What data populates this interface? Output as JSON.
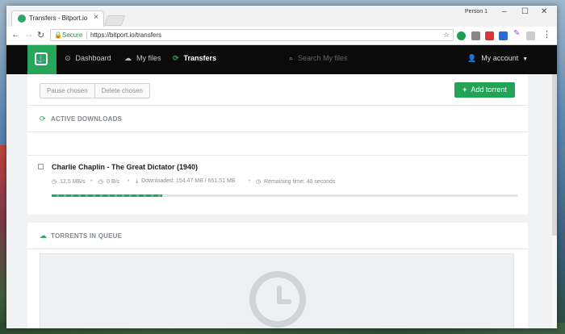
{
  "browser": {
    "tab_title": "Transfers - Bitport.io",
    "tab_close": "×",
    "profile_name": "Person 1",
    "win_min": "–",
    "win_max": "☐",
    "win_close": "✕",
    "secure_label": "Secure",
    "url": "https://bitport.io/transfers",
    "star": "☆",
    "menu": "⋮",
    "nav_back": "←",
    "nav_fwd": "→",
    "nav_reload": "↻"
  },
  "app": {
    "brand_color": "#27a55b",
    "logo_glyph": "⚓",
    "nav": {
      "dashboard": "Dashboard",
      "dashboard_icon": "⊙",
      "files": "My files",
      "files_icon": "☁",
      "transfers": "Transfers",
      "transfers_icon": "⟳",
      "search_placeholder": "Search My files",
      "search_icon": "⌕",
      "account": "My account",
      "account_icon": "👤",
      "account_caret": "▼"
    },
    "actions": {
      "pause": "Pause chosen",
      "delete": "Delete chosen",
      "add": "Add torrent",
      "add_icon": "+"
    },
    "active": {
      "heading": "ACTIVE DOWNLOADS",
      "icon": "⟳"
    },
    "torrent": {
      "name": "Charlie Chaplin - The Great Dictator (1940)",
      "down_speed": "12.5 MB/s",
      "up_speed": "0 B/s",
      "downloaded": "Downloaded: 154.47 MB / 651.51 MB",
      "remaining": "Remaining time: 40 seconds",
      "progress_fraction": 0.237,
      "dot": "•"
    },
    "queue": {
      "heading": "TORRENTS IN QUEUE",
      "icon": "☁"
    }
  }
}
